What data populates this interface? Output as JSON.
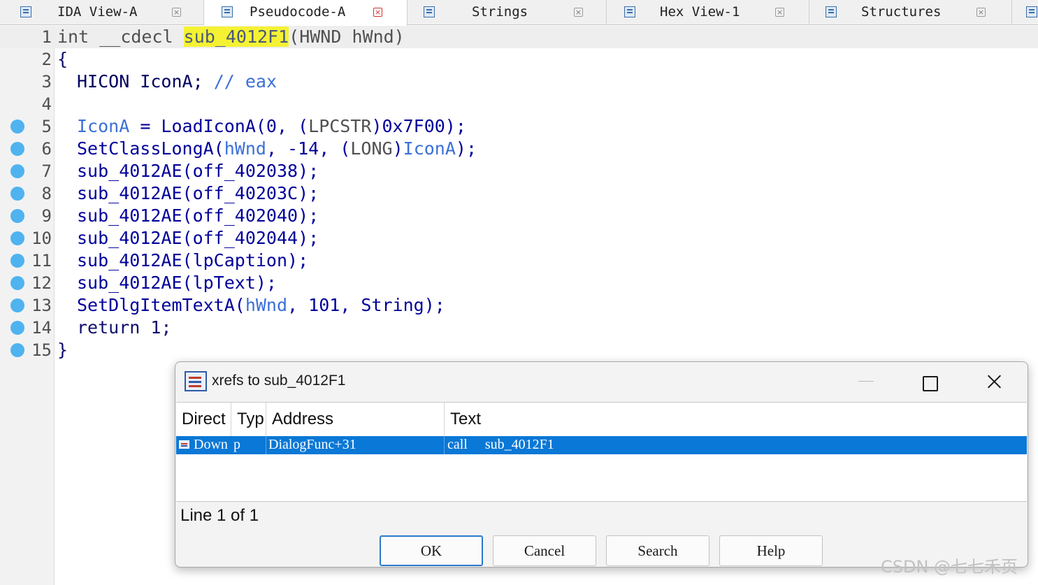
{
  "tabs": [
    {
      "label": "IDA View-A",
      "icon": "disassembly-icon",
      "active": false
    },
    {
      "label": "Pseudocode-A",
      "icon": "pseudocode-icon",
      "active": true
    },
    {
      "label": "Strings",
      "icon": "strings-icon",
      "active": false
    },
    {
      "label": "Hex View-1",
      "icon": "hex-view-icon",
      "active": false
    },
    {
      "label": "Structures",
      "icon": "structures-icon",
      "active": false
    }
  ],
  "tab_close_glyph": "×",
  "code": {
    "line_numbers": [
      "1",
      "2",
      "3",
      "4",
      "5",
      "6",
      "7",
      "8",
      "9",
      "10",
      "11",
      "12",
      "13",
      "14",
      "15"
    ],
    "l1": {
      "kw": "int",
      "conv": "__cdecl",
      "func": "sub_4012F1",
      "rest": "(HWND hWnd)"
    },
    "l2": "{",
    "l3": {
      "type": "HICON IconA;",
      "comment": "// ",
      "reg": "eax"
    },
    "l5": {
      "var": "IconA",
      "eq": " = LoadIconA(0, (",
      "cast": "LPCSTR",
      "tail": ")0x7F00);"
    },
    "l6": {
      "fn": "SetClassLongA(",
      "var": "hWnd",
      "mid": ", -14, (",
      "cast": "LONG",
      "cast_close": ")",
      "var2": "IconA",
      "tail": ");"
    },
    "l7": "sub_4012AE(off_402038);",
    "l8": "sub_4012AE(off_40203C);",
    "l9": "sub_4012AE(off_402040);",
    "l10": "sub_4012AE(off_402044);",
    "l11": "sub_4012AE(lpCaption);",
    "l12": "sub_4012AE(lpText);",
    "l13": {
      "fn": "SetDlgItemTextA(",
      "var": "hWnd",
      "tail": ", 101, String);"
    },
    "l14": "return 1;",
    "l15": "}"
  },
  "dialog": {
    "title": "xrefs to sub_4012F1",
    "columns": [
      "Direct",
      "Typ",
      "Address",
      "Text"
    ],
    "rows": [
      {
        "direction": "Down",
        "type": "p",
        "address": "DialogFunc+31",
        "text": "call     sub_4012F1"
      }
    ],
    "status": "Line 1 of 1",
    "buttons": {
      "ok": "OK",
      "cancel": "Cancel",
      "search": "Search",
      "help": "Help"
    }
  },
  "watermark": "CSDN @七七禾页",
  "colors": {
    "selection": "#0a78d6",
    "highlight": "#f5f233",
    "breakpoint": "#4fb3f0"
  }
}
